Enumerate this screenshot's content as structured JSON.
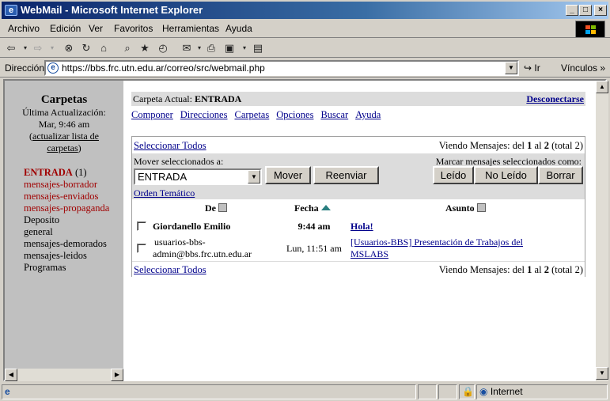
{
  "window": {
    "title": "WebMail - Microsoft Internet Explorer"
  },
  "menu": {
    "items": [
      "Archivo",
      "Edición",
      "Ver",
      "Favoritos",
      "Herramientas",
      "Ayuda"
    ]
  },
  "address": {
    "label": "Dirección",
    "url": "https://bbs.frc.utn.edu.ar/correo/src/webmail.php",
    "go_label": "Ir",
    "links_label": "Vínculos"
  },
  "sidebar": {
    "title": "Carpetas",
    "last_update_label": "Última Actualización:",
    "last_update_time": "Mar, 9:46 am",
    "refresh_open": "(",
    "refresh_line1": "actualizar lista de",
    "refresh_line2": "carpetas",
    "refresh_close": ")",
    "folders": [
      {
        "name": "ENTRADA",
        "count": "(1)"
      },
      {
        "name": "mensajes-borrador"
      },
      {
        "name": "mensajes-enviados"
      },
      {
        "name": "mensajes-propaganda"
      },
      {
        "name": "Deposito"
      },
      {
        "name": "general"
      },
      {
        "name": "mensajes-demorados"
      },
      {
        "name": "mensajes-leidos"
      },
      {
        "name": "Programas"
      }
    ]
  },
  "main": {
    "current_folder_label": "Carpeta Actual:",
    "current_folder": "ENTRADA",
    "logout": "Desconectarse",
    "nav": [
      "Componer",
      "Direcciones",
      "Carpetas",
      "Opciones",
      "Buscar",
      "Ayuda"
    ],
    "select_all": "Seleccionar Todos",
    "viewing": {
      "prefix": "Viendo Mensajes: del",
      "from": "1",
      "al": "al",
      "to": "2",
      "total": "(total 2)"
    },
    "move_label": "Mover seleccionados a:",
    "move_select_value": "ENTRADA",
    "move_button": "Mover",
    "forward_button": "Reenviar",
    "mark_label": "Marcar mensajes seleccionados como:",
    "read_button": "Leído",
    "unread_button": "No Leído",
    "delete_button": "Borrar",
    "thread_link": "Orden Temático",
    "columns": {
      "from": "De",
      "date": "Fecha",
      "subject": "Asunto"
    },
    "messages": [
      {
        "from": "Giordanello Emilio",
        "date": "9:44 am",
        "subject": "Hola!",
        "unread": true
      },
      {
        "from_line1": "usuarios-bbs-",
        "from_line2": "admin@bbs.frc.utn.edu.ar",
        "date": "Lun, 11:51 am",
        "subject_line1": "[Usuarios-BBS] Presentación de Trabajos del",
        "subject_line2": "MSLABS",
        "unread": false
      }
    ]
  },
  "status": {
    "zone": "Internet"
  }
}
